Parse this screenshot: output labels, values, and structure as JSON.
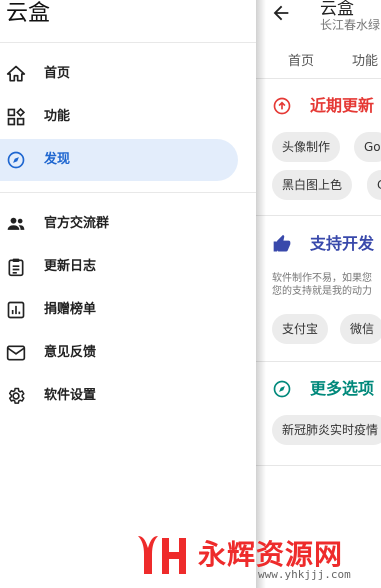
{
  "drawer": {
    "title": "云盒",
    "items": [
      {
        "label": "首页",
        "icon": "home-icon",
        "active": false
      },
      {
        "label": "功能",
        "icon": "dashboard-icon",
        "active": false
      },
      {
        "label": "发现",
        "icon": "compass-icon",
        "active": true
      },
      {
        "label": "官方交流群",
        "icon": "group-icon",
        "active": false
      },
      {
        "label": "更新日志",
        "icon": "clipboard-icon",
        "active": false
      },
      {
        "label": "捐赠榜单",
        "icon": "chart-icon",
        "active": false
      },
      {
        "label": "意见反馈",
        "icon": "mail-icon",
        "active": false
      },
      {
        "label": "软件设置",
        "icon": "gear-icon",
        "active": false
      }
    ]
  },
  "background": {
    "title": "云盒",
    "subtitle": "长江春水绿",
    "tabs": [
      "首页",
      "功能"
    ],
    "sections": {
      "recent": {
        "title": "近期更新",
        "color": "#e53935",
        "icon": "arrow-up-circle-icon",
        "chips": [
          "头像制作",
          "Go",
          "黑白图上色",
          "C"
        ]
      },
      "support": {
        "title": "支持开发",
        "color": "#3949ab",
        "icon": "thumb-up-icon",
        "desc_lines": [
          "软件制作不易，如果您",
          "您的支持就是我的动力"
        ],
        "chips": [
          "支付宝",
          "微信"
        ]
      },
      "more": {
        "title": "更多选项",
        "color": "#00897b",
        "icon": "compass-icon",
        "chips": [
          "新冠肺炎实时疫情"
        ]
      }
    }
  },
  "watermark": {
    "text": "永辉资源网",
    "url": "www.yhkjjj.com",
    "color": "#ee2b2b"
  }
}
